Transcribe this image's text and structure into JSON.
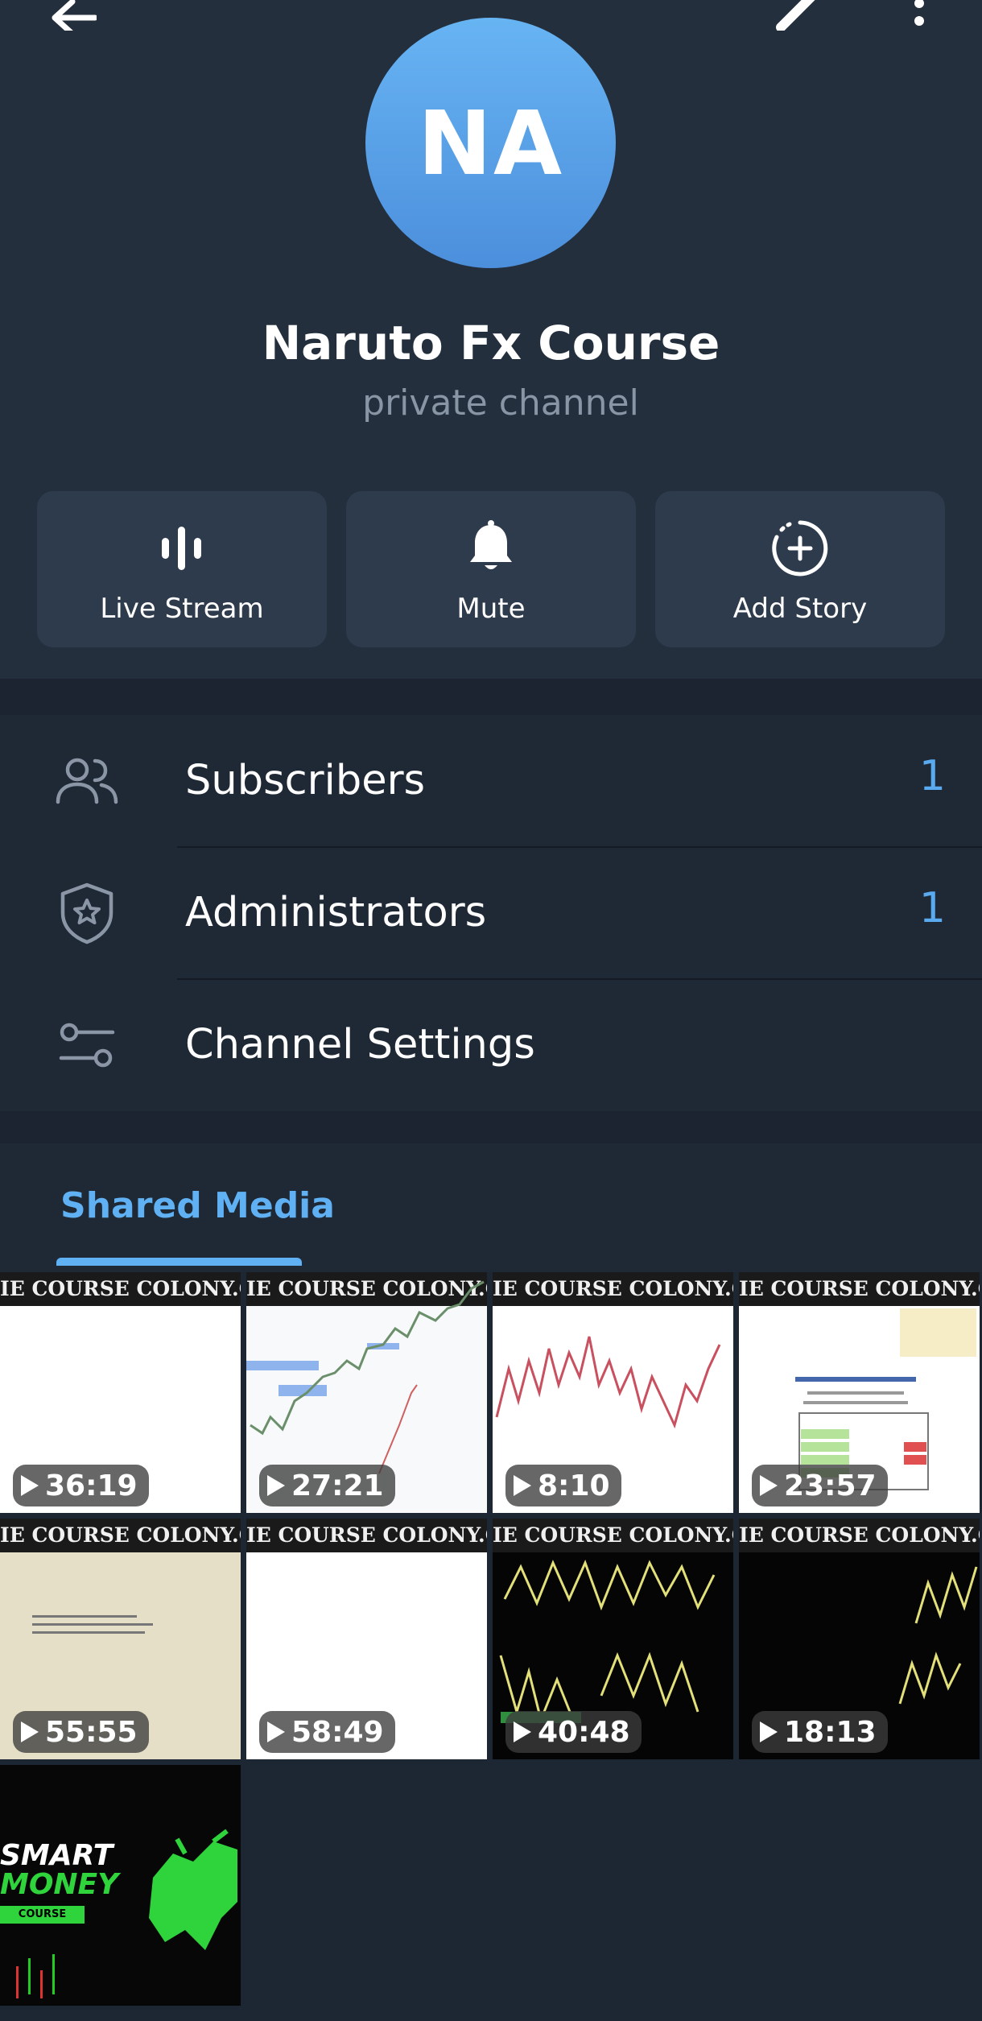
{
  "top_bar": {
    "back_icon": "arrow-left-icon",
    "edit_icon": "pencil-icon",
    "more_icon": "more-vertical-icon"
  },
  "profile": {
    "initials": "NA",
    "name": "Naruto Fx Course",
    "subtitle": "private channel",
    "avatar_color": "#5ba4ec"
  },
  "actions": [
    {
      "label": "Live Stream",
      "icon": "live-stream-icon"
    },
    {
      "label": "Mute",
      "icon": "bell-icon"
    },
    {
      "label": "Add Story",
      "icon": "add-story-icon"
    }
  ],
  "info_rows": [
    {
      "label": "Subscribers",
      "value": "1",
      "icon": "people-icon"
    },
    {
      "label": "Administrators",
      "value": "1",
      "icon": "shield-star-icon"
    },
    {
      "label": "Channel Settings",
      "value": "",
      "icon": "settings-sliders-icon"
    }
  ],
  "shared_media": {
    "tab_label": "Shared Media",
    "items": [
      {
        "duration": "36:19",
        "watermark": "IE COURSE COLONY.COI"
      },
      {
        "duration": "27:21",
        "watermark": "IE COURSE COLONY.COI"
      },
      {
        "duration": "8:10",
        "watermark": "IE COURSE COLONY.COI"
      },
      {
        "duration": "23:57",
        "watermark": "IE COURSE COLONY.COI"
      },
      {
        "duration": "55:55",
        "watermark": "IE COURSE COLONY.COI"
      },
      {
        "duration": "58:49",
        "watermark": "IE COURSE COLONY.COI"
      },
      {
        "duration": "40:48",
        "watermark": "IE COURSE COLONY.COI"
      },
      {
        "duration": "18:13",
        "watermark": "IE COURSE COLONY.COI"
      },
      {
        "line1": "SMART",
        "line2": "MONEY",
        "line3": "COURSE"
      }
    ]
  },
  "colors": {
    "accent": "#5fb1f4",
    "background": "#1d2733",
    "panel": "#242f3d",
    "card": "#2e3b4c"
  }
}
